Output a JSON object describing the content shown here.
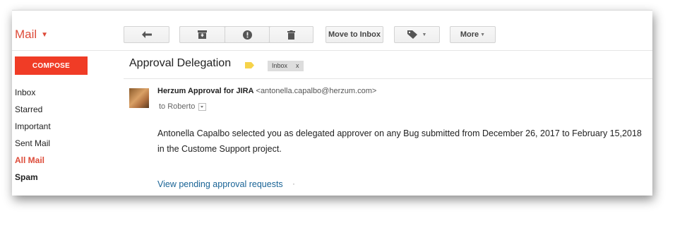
{
  "app": {
    "brand": "Mail"
  },
  "toolbar": {
    "move_to_inbox": "Move to Inbox",
    "more": "More",
    "icons": [
      "reply-icon",
      "archive-icon",
      "report-spam-icon",
      "trash-icon",
      "label-icon"
    ]
  },
  "sidebar": {
    "compose": "COMPOSE",
    "items": [
      {
        "label": "Inbox"
      },
      {
        "label": "Starred"
      },
      {
        "label": "Important"
      },
      {
        "label": "Sent Mail"
      },
      {
        "label": "All Mail",
        "active": true
      },
      {
        "label": "Spam"
      }
    ]
  },
  "message": {
    "subject": "Approval Delegation",
    "labels": [
      {
        "name": "Inbox",
        "remove": "x"
      }
    ],
    "sender_name": "Herzum Approval for JIRA",
    "sender_email": "<antonella.capalbo@herzum.com>",
    "to": "to Roberto",
    "body_line1": "Antonella Capalbo selected you as delegated approver on any Bug submitted from December 26, 2017 to February 15,2018",
    "body_line2": "in the Custome Support project.",
    "link": "View pending approval requests",
    "trailing": "·"
  },
  "colors": {
    "accent": "#dd4b39",
    "compose_bg": "#f03c26",
    "link": "#1a6496",
    "tag": "#f6d34a"
  }
}
